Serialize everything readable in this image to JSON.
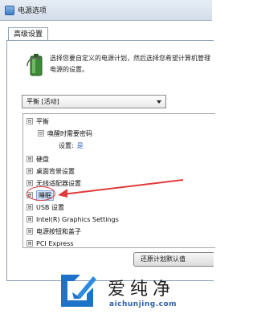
{
  "window": {
    "title": "电源选项",
    "icon": "power-options-icon"
  },
  "tabs": [
    {
      "label": "高级设置"
    }
  ],
  "description": "选择您要自定义的电源计划，然后选择您希望计算机管理电源的设置。",
  "plan_select": {
    "value": "平衡 [活动]"
  },
  "tree": {
    "items": [
      {
        "expander": "⊟",
        "label": "平衡"
      },
      {
        "expander": "⊟",
        "label": "唤醒时需要密码"
      },
      {
        "label": "设置:",
        "value": "是"
      },
      {
        "expander": "⊞",
        "label": "硬盘"
      },
      {
        "expander": "⊞",
        "label": "桌面背景设置"
      },
      {
        "expander": "⊞",
        "label": "无线适配器设置"
      },
      {
        "expander": "⊞",
        "label": "睡眠"
      },
      {
        "expander": "⊞",
        "label": "USB 设置"
      },
      {
        "expander": "⊞",
        "label": "Intel(R) Graphics Settings"
      },
      {
        "expander": "⊞",
        "label": "电源按钮和盖子"
      },
      {
        "expander": "⊞",
        "label": "PCI Express"
      }
    ]
  },
  "buttons": {
    "restore_defaults": "还原计划默认值"
  },
  "watermark": {
    "text": "爱纯净",
    "url": "aichunjing.com"
  },
  "colors": {
    "annotation": "#e03b3b",
    "selection": "#cfe3fb",
    "watermark_url": "#2c5fa8"
  }
}
